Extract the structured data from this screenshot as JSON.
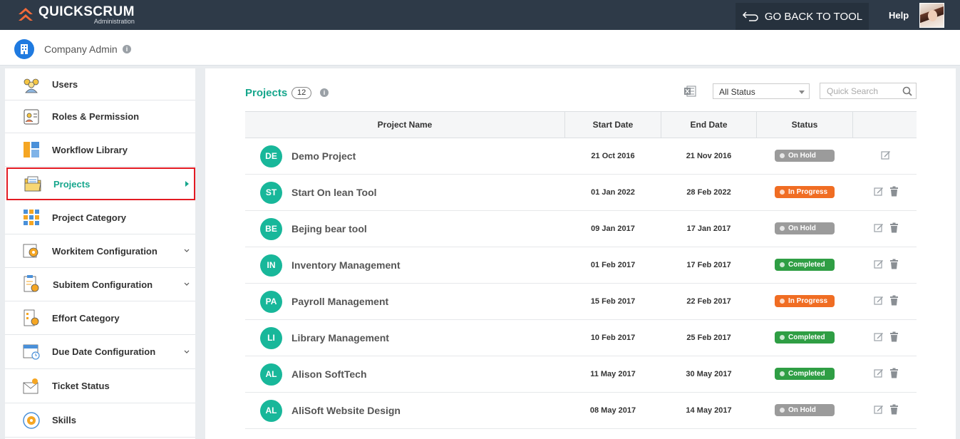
{
  "header": {
    "logo_name": "QUICKSCRUM",
    "logo_sub": "Administration",
    "back_label": "GO BACK TO TOOL",
    "help_label": "Help"
  },
  "subheader": {
    "company_label": "Company Admin"
  },
  "sidebar": {
    "items": [
      {
        "label": "Users",
        "icon": "users-icon"
      },
      {
        "label": "Roles & Permission",
        "icon": "roles-icon"
      },
      {
        "label": "Workflow Library",
        "icon": "workflow-icon"
      },
      {
        "label": "Projects",
        "icon": "projects-icon",
        "active": true
      },
      {
        "label": "Project Category",
        "icon": "category-icon"
      },
      {
        "label": "Workitem Configuration",
        "icon": "workitem-icon",
        "expandable": true
      },
      {
        "label": "Subitem Configuration",
        "icon": "subitem-icon",
        "expandable": true
      },
      {
        "label": "Effort Category",
        "icon": "effort-icon"
      },
      {
        "label": "Due Date Configuration",
        "icon": "calendar-icon",
        "expandable": true
      },
      {
        "label": "Ticket Status",
        "icon": "ticket-icon"
      },
      {
        "label": "Skills",
        "icon": "skills-icon"
      }
    ]
  },
  "main": {
    "title": "Projects",
    "count": "12",
    "status_filter": "All Status",
    "search_placeholder": "Quick Search",
    "columns": [
      "Project Name",
      "Start Date",
      "End Date",
      "Status"
    ],
    "rows": [
      {
        "initials": "DE",
        "name": "Demo Project",
        "start": "21 Oct 2016",
        "end": "21 Nov 2016",
        "status": "On Hold",
        "status_kind": "hold",
        "deletable": false
      },
      {
        "initials": "ST",
        "name": "Start On lean Tool",
        "start": "01 Jan 2022",
        "end": "28 Feb 2022",
        "status": "In Progress",
        "status_kind": "prog",
        "deletable": true
      },
      {
        "initials": "BE",
        "name": "Bejing bear tool",
        "start": "09 Jan 2017",
        "end": "17 Jan 2017",
        "status": "On Hold",
        "status_kind": "hold",
        "deletable": true
      },
      {
        "initials": "IN",
        "name": "Inventory Management",
        "start": "01 Feb 2017",
        "end": "17 Feb 2017",
        "status": "Completed",
        "status_kind": "done",
        "deletable": true
      },
      {
        "initials": "PA",
        "name": "Payroll Management",
        "start": "15 Feb 2017",
        "end": "22 Feb 2017",
        "status": "In Progress",
        "status_kind": "prog",
        "deletable": true
      },
      {
        "initials": "LI",
        "name": "Library Management",
        "start": "10 Feb 2017",
        "end": "25 Feb 2017",
        "status": "Completed",
        "status_kind": "done",
        "deletable": true
      },
      {
        "initials": "AL",
        "name": "Alison SoftTech",
        "start": "11 May 2017",
        "end": "30 May 2017",
        "status": "Completed",
        "status_kind": "done",
        "deletable": true
      },
      {
        "initials": "AL",
        "name": "AliSoft Website Design",
        "start": "08 May 2017",
        "end": "14 May 2017",
        "status": "On Hold",
        "status_kind": "hold",
        "deletable": true
      }
    ]
  },
  "colors": {
    "accent": "#16a68c",
    "topbar": "#2e3a48",
    "hold": "#9b9b9b",
    "in_progress": "#f06d23",
    "completed": "#2f9e44",
    "active_border": "#e31b23"
  }
}
